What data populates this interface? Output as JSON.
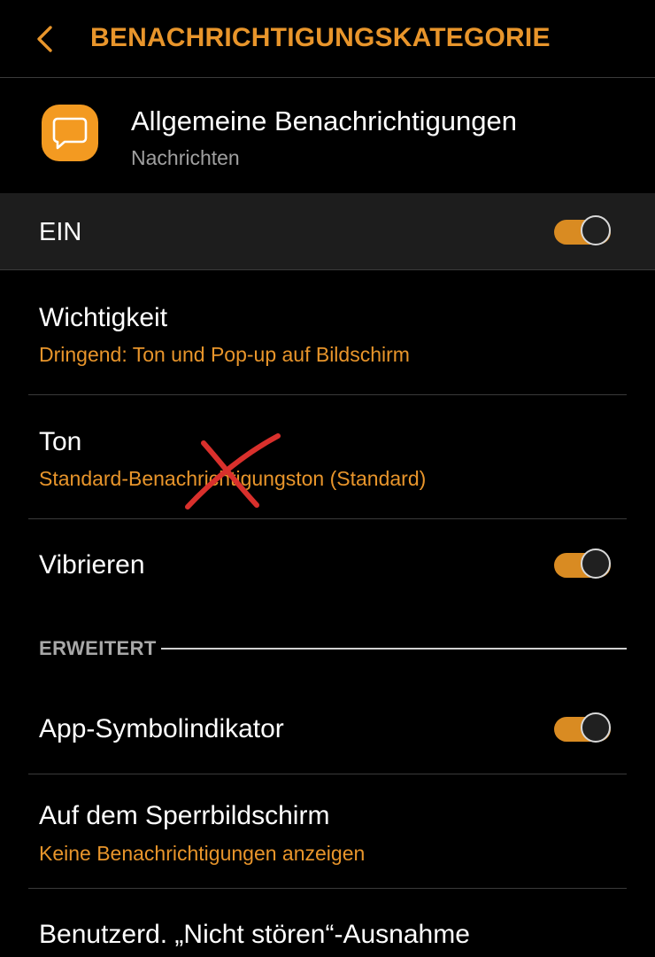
{
  "colors": {
    "accent": "#e8952b",
    "toggle_on": "#d98b22",
    "app_icon_bg": "#f39a21",
    "text_primary": "#ffffff",
    "text_secondary": "#9e9e9e",
    "annotation": "#d9302c"
  },
  "header": {
    "back_icon": "chevron-left-icon",
    "title": "BENACHRICHTIGUNGSKATEGORIE"
  },
  "app": {
    "icon": "chat-bubble-icon",
    "name": "Allgemeine Benachrichtigungen",
    "category": "Nachrichten"
  },
  "master": {
    "label": "EIN",
    "enabled": true
  },
  "settings": {
    "importance": {
      "title": "Wichtigkeit",
      "value": "Dringend: Ton und Pop-up auf Bildschirm"
    },
    "sound": {
      "title": "Ton",
      "value": "Standard-Benachrichtigungston (Standard)"
    },
    "vibrate": {
      "title": "Vibrieren",
      "enabled": true
    }
  },
  "advanced": {
    "section_label": "ERWEITERT",
    "badge": {
      "title": "App-Symbolindikator",
      "enabled": true
    },
    "lock_screen": {
      "title": "Auf dem Sperrbildschirm",
      "value": "Keine Benachrichtigungen anzeigen"
    },
    "dnd_exception": {
      "title": "Benutzerd. „Nicht stören“-Ausnahme"
    }
  }
}
